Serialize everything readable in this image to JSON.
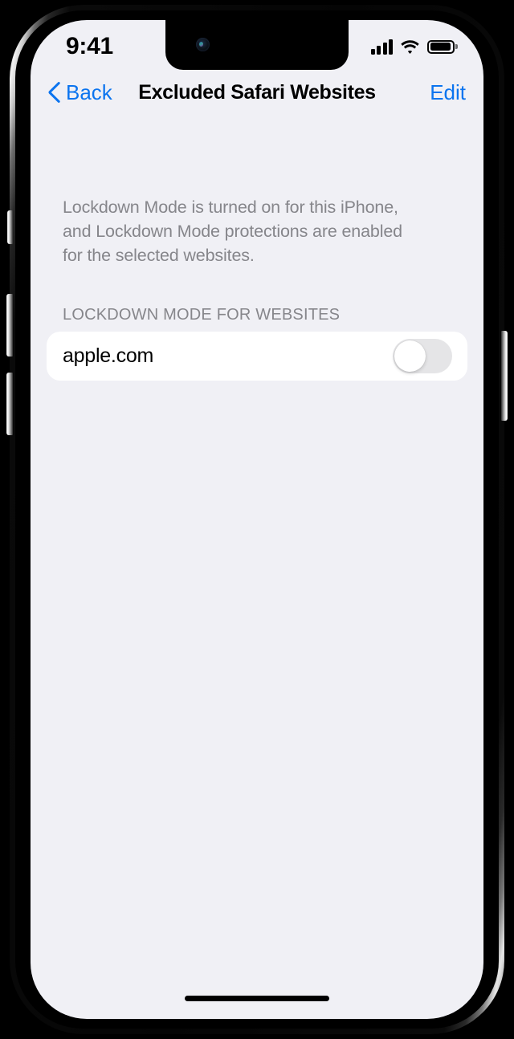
{
  "status_bar": {
    "time": "9:41",
    "signal_icon": "cellular-signal-icon",
    "signal_bars": 4,
    "wifi_icon": "wifi-icon",
    "battery_icon": "battery-icon",
    "battery_level": "full"
  },
  "nav_bar": {
    "back_label": "Back",
    "back_icon": "chevron-left-icon",
    "title": "Excluded Safari Websites",
    "edit_label": "Edit"
  },
  "content": {
    "description": "Lockdown Mode is turned on for this iPhone, and Lockdown Mode protections are enabled for the selected websites.",
    "section_header": "LOCKDOWN MODE FOR WEBSITES",
    "rows": [
      {
        "label": "apple.com",
        "toggle_state": "off"
      }
    ]
  },
  "colors": {
    "accent_blue": "#0B74EF",
    "screen_background": "#F0F0F5",
    "card_background": "#FFFFFF",
    "secondary_text": "#86868B",
    "toggle_off_track": "#E5E5E7"
  }
}
